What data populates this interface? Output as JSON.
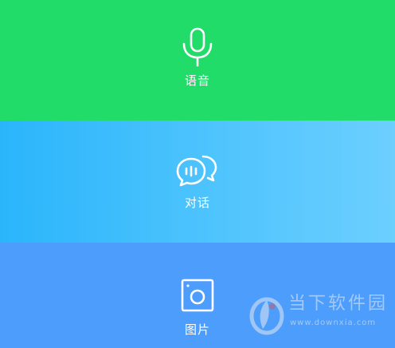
{
  "panels": {
    "voice": {
      "label": "语音",
      "icon": "microphone-icon",
      "color": "#21dc69"
    },
    "chat": {
      "label": "对话",
      "icon": "chat-bubbles-icon",
      "color": "#4fc4fd"
    },
    "image": {
      "label": "图片",
      "icon": "camera-icon",
      "color": "#4d9dfc"
    }
  },
  "watermark": {
    "title": "当下软件园",
    "url": "www.downxia.com"
  }
}
